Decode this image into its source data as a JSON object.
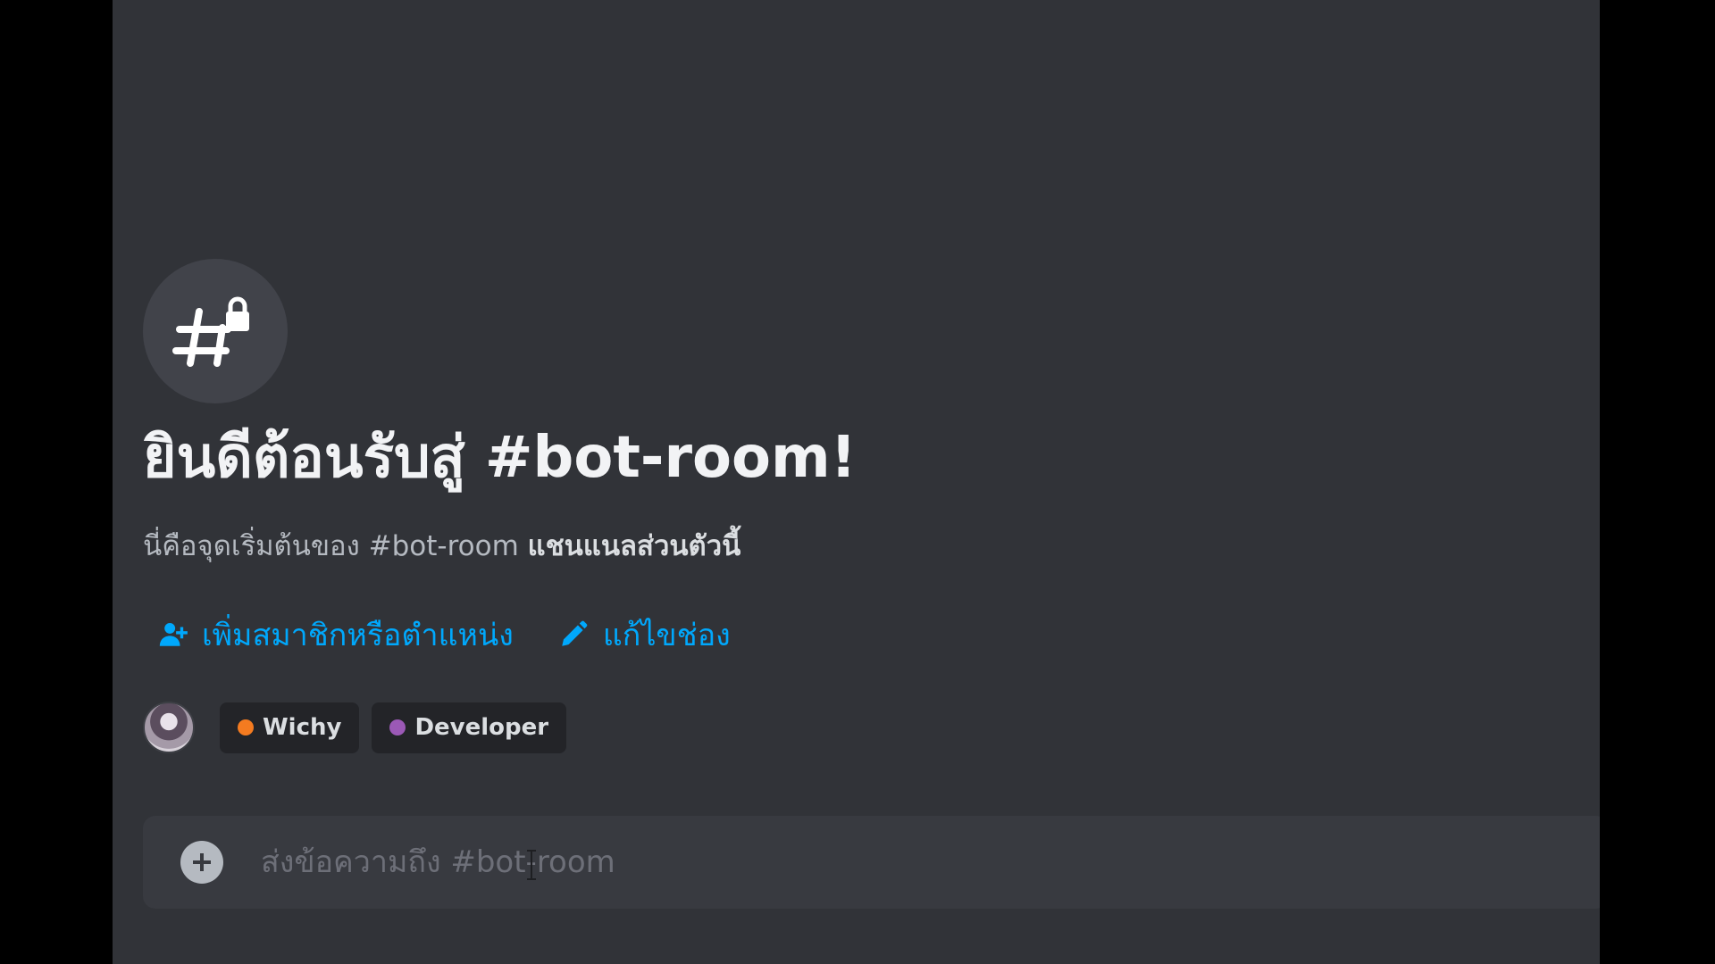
{
  "channel": {
    "name": "#bot-room",
    "icon": "hash-lock-icon"
  },
  "welcome": {
    "title": "ยินดีต้อนรับสู่ #bot-room!",
    "subtitle_prefix": "นี่คือจุดเริ่มต้นของ #bot-room ",
    "subtitle_bold": "แชนแนลส่วนตัวนี้"
  },
  "actions": [
    {
      "label": "เพิ่มสมาชิกหรือตำแหน่ง",
      "icon": "add-member-icon"
    },
    {
      "label": "แก้ไขช่อง",
      "icon": "pencil-icon"
    }
  ],
  "members": {
    "avatar": "user-avatar",
    "chips": [
      {
        "label": "Wichy",
        "color": "#f47b20"
      },
      {
        "label": "Developer",
        "color": "#9b59b6"
      }
    ]
  },
  "composer": {
    "placeholder": "ส่งข้อความถึง #bot-room",
    "value": ""
  },
  "colors": {
    "background": "#313338",
    "link": "#00a8fc",
    "chip_bg": "#232428"
  }
}
